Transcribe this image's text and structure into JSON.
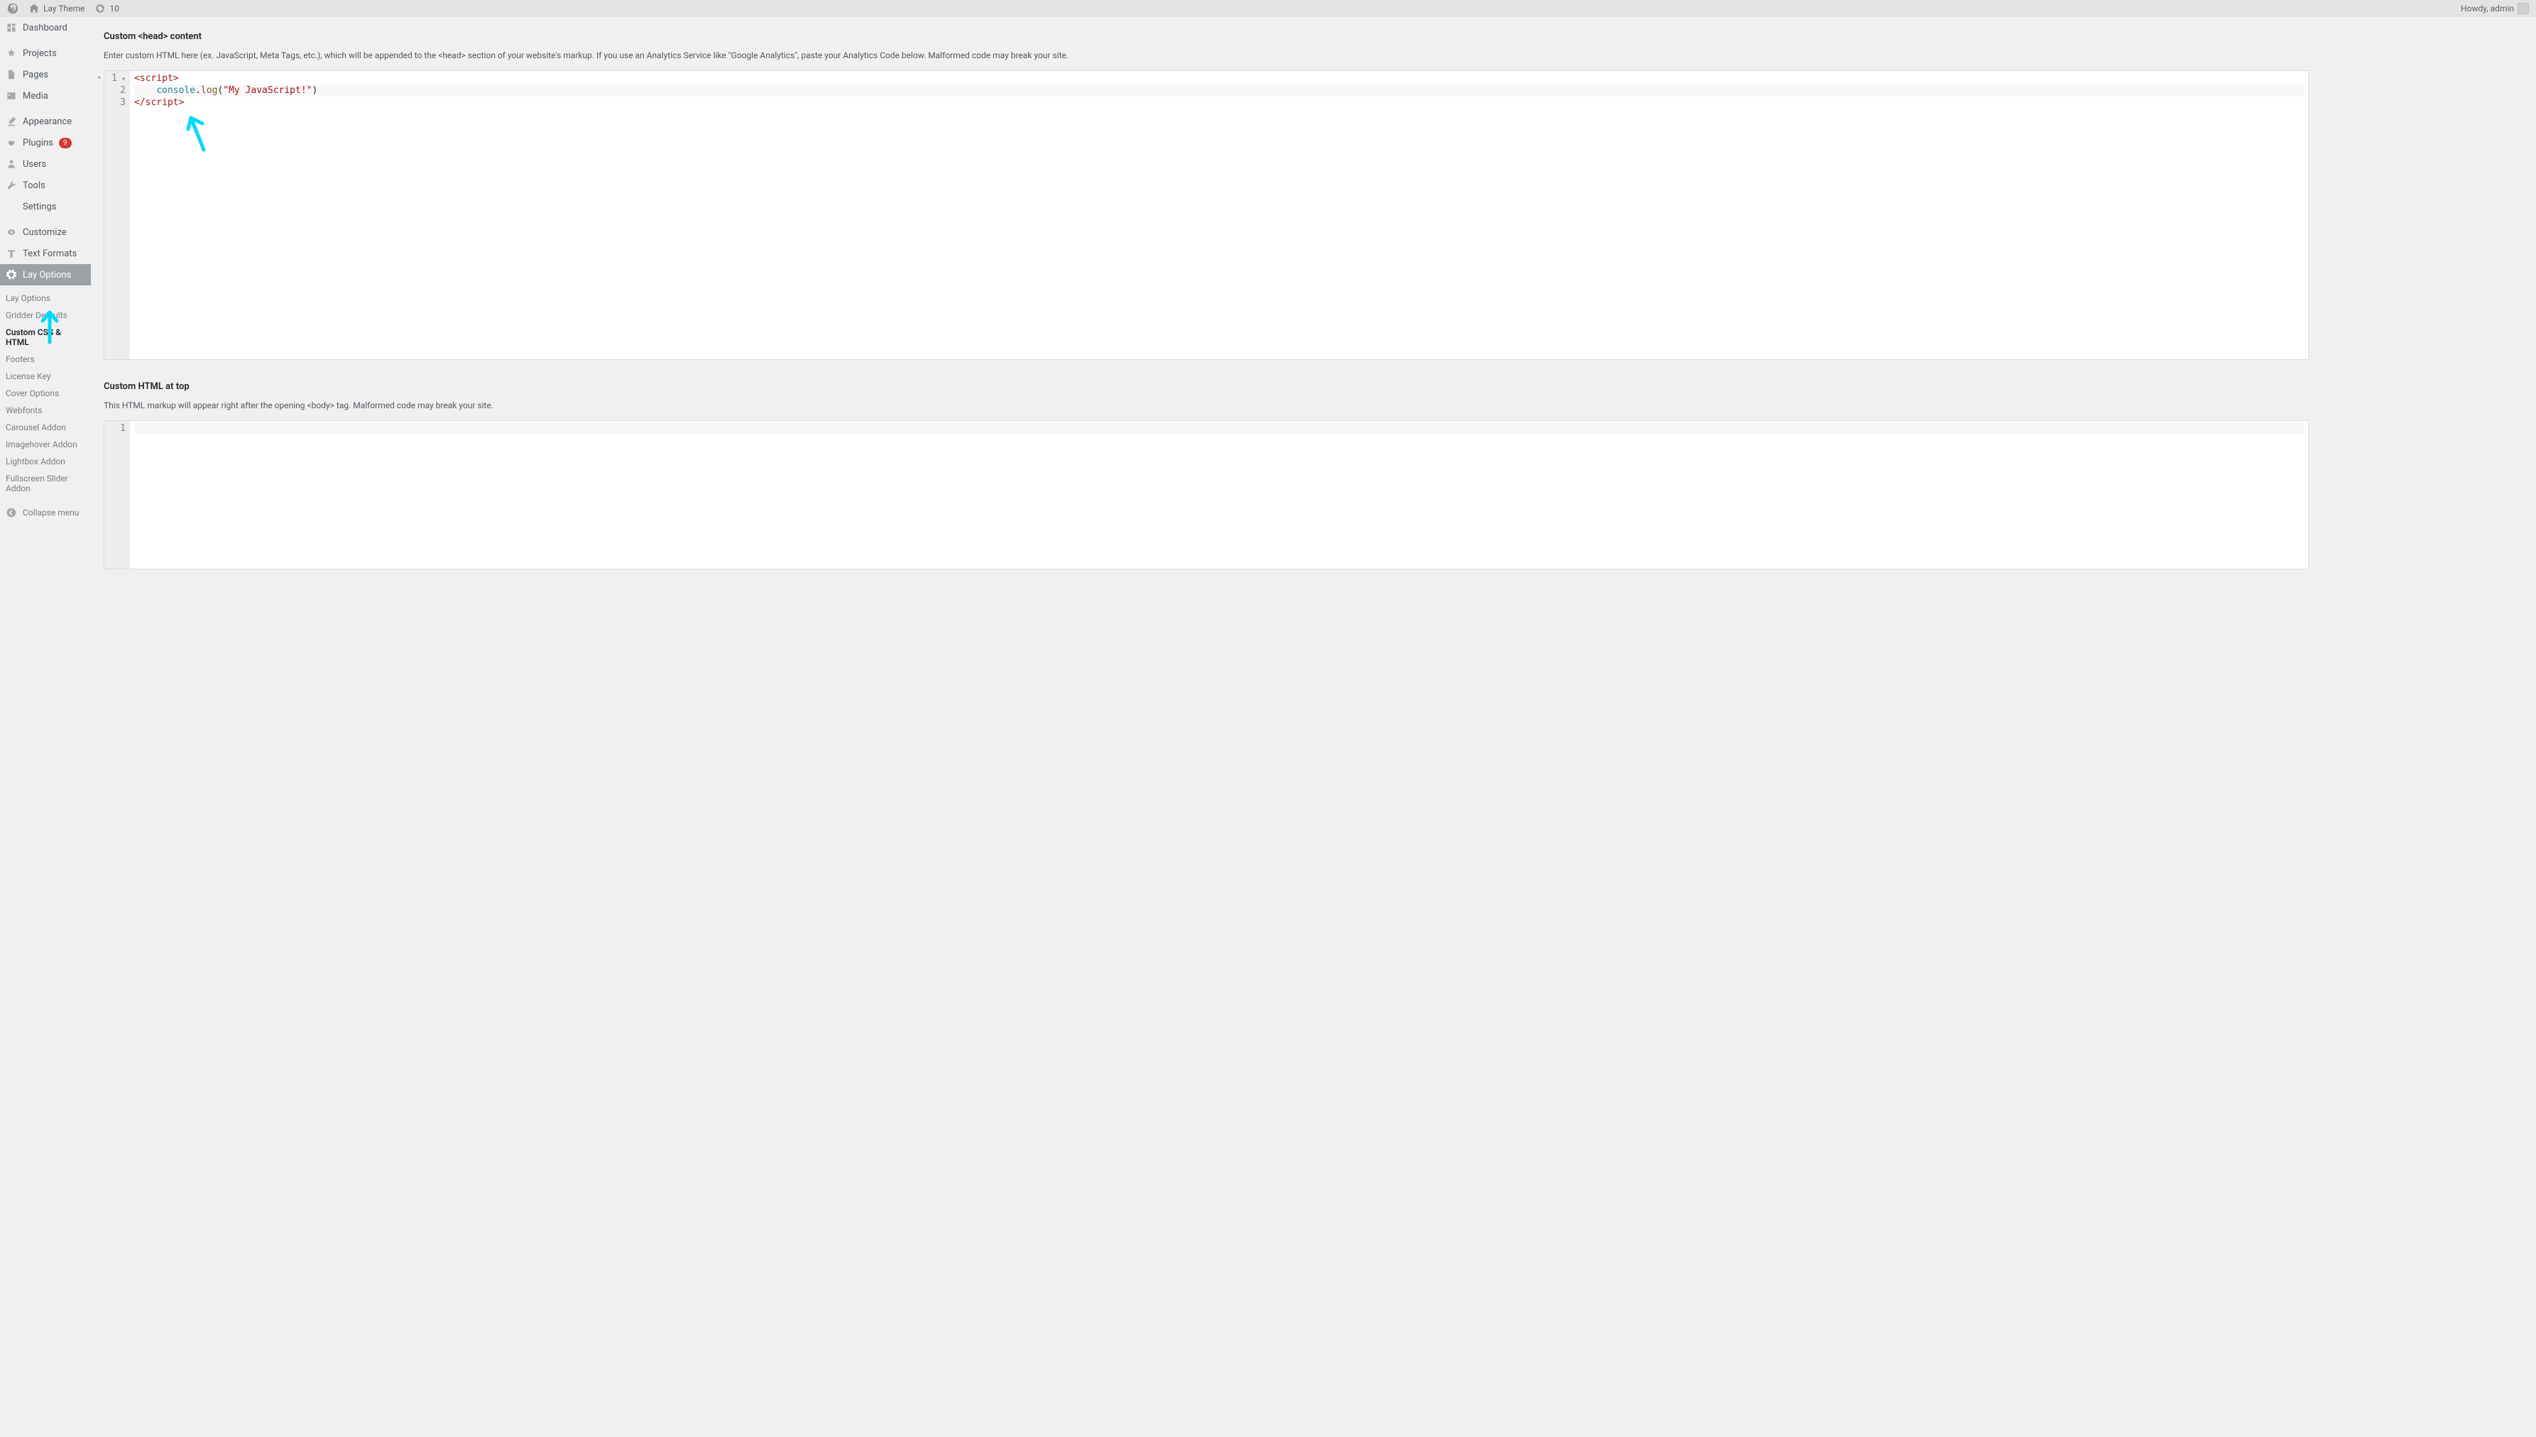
{
  "adminbar": {
    "site_name": "Lay Theme",
    "updates_count": "10",
    "howdy_prefix": "Howdy, ",
    "user": "admin"
  },
  "sidebar": {
    "main": [
      {
        "key": "dashboard",
        "label": "Dashboard",
        "icon": "dashboard"
      },
      {
        "key": "projects",
        "label": "Projects",
        "icon": "pin"
      },
      {
        "key": "pages",
        "label": "Pages",
        "icon": "pages"
      },
      {
        "key": "media",
        "label": "Media",
        "icon": "media"
      },
      {
        "key": "appearance",
        "label": "Appearance",
        "icon": "brush"
      },
      {
        "key": "plugins",
        "label": "Plugins",
        "icon": "plug",
        "badge": "9"
      },
      {
        "key": "users",
        "label": "Users",
        "icon": "user"
      },
      {
        "key": "tools",
        "label": "Tools",
        "icon": "wrench"
      },
      {
        "key": "settings",
        "label": "Settings",
        "icon": "sliders"
      },
      {
        "key": "customize",
        "label": "Customize",
        "icon": "eye"
      },
      {
        "key": "textfmt",
        "label": "Text Formats",
        "icon": "text"
      },
      {
        "key": "layoptions",
        "label": "Lay Options",
        "icon": "gear",
        "active": true
      }
    ],
    "sub": [
      {
        "label": "Lay Options"
      },
      {
        "label": "Gridder Defaults"
      },
      {
        "label": "Custom CSS & HTML",
        "current": true
      },
      {
        "label": "Footers"
      },
      {
        "label": "License Key"
      },
      {
        "label": "Cover Options"
      },
      {
        "label": "Webfonts"
      },
      {
        "label": "Carousel Addon"
      },
      {
        "label": "Imagehover Addon"
      },
      {
        "label": "Lightbox Addon"
      },
      {
        "label": "Fullscreen Slider Addon"
      }
    ],
    "collapse_label": "Collapse menu"
  },
  "sections": {
    "head": {
      "title": "Custom <head> content",
      "desc": "Enter custom HTML here (ex. JavaScript, Meta Tags, etc.), which will be appended to the <head> section of your website's markup. If you use an Analytics Service like \"Google Analytics\", paste your Analytics Code below. Malformed code may break your site.",
      "code": {
        "lines": [
          "1",
          "2",
          "3"
        ],
        "l1_tag": "<script>",
        "l2_indent": "    ",
        "l2_obj": "console",
        "l2_dot": ".",
        "l2_fn": "log",
        "l2_open": "(",
        "l2_str": "\"My JavaScript!\"",
        "l2_close": ")",
        "l3_tag": "</script>"
      }
    },
    "top": {
      "title": "Custom HTML at top",
      "desc": "This HTML markup will appear right after the opening <body> tag. Malformed code may break your site.",
      "code": {
        "lines": [
          "1"
        ]
      }
    }
  }
}
